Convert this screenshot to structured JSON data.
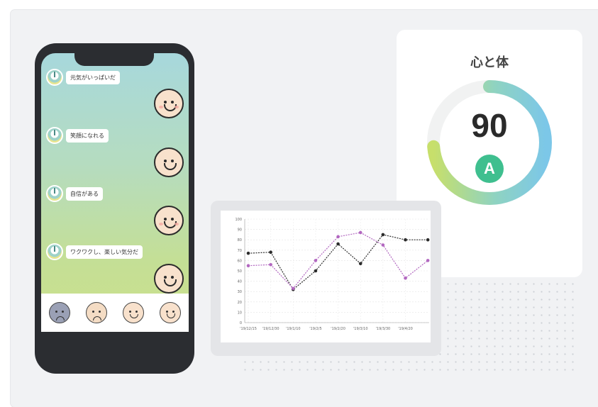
{
  "chat": {
    "messages": [
      "元気がいっぱいだ",
      "笑顔になれる",
      "自信がある",
      "ワクワクし、楽しい気分だ"
    ]
  },
  "mood_icons": [
    "very-sad-face-icon",
    "worried-face-icon",
    "content-face-icon",
    "happy-face-icon"
  ],
  "score_card": {
    "title": "心と体",
    "score": "90",
    "grade": "A",
    "progress_percent": 90,
    "ring_colors": [
      "#c7df6b",
      "#8fd3c1",
      "#7cc7e8"
    ]
  },
  "chart_data": {
    "type": "line",
    "categories": [
      "'19/12/15",
      "'19/12/30",
      "'19/1/10",
      "'19/2/5",
      "'19/2/20",
      "'19/3/10",
      "'19/3/30",
      "'19/4/20"
    ],
    "ylim": [
      0,
      100
    ],
    "yticks": [
      0,
      10,
      20,
      30,
      40,
      50,
      60,
      70,
      80,
      90,
      100
    ],
    "series": [
      {
        "color": "#2b2b2b",
        "values": [
          67,
          68,
          32,
          50,
          76,
          57,
          85,
          80,
          80
        ]
      },
      {
        "color": "#b267c0",
        "values": [
          55,
          56,
          33,
          60,
          83,
          87,
          75,
          43,
          60
        ]
      }
    ],
    "x_positions_extra_label": "",
    "grid": true
  }
}
